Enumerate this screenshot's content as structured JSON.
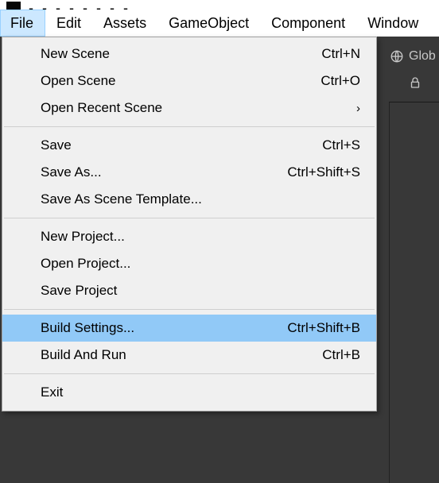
{
  "titlebar": {
    "partial_text": "- - - - - - - -"
  },
  "menubar": {
    "items": [
      {
        "label": "File",
        "open": true
      },
      {
        "label": "Edit"
      },
      {
        "label": "Assets"
      },
      {
        "label": "GameObject"
      },
      {
        "label": "Component"
      },
      {
        "label": "Window"
      }
    ]
  },
  "toolbar": {
    "global_label": "Glob"
  },
  "dropdown": {
    "items": [
      {
        "type": "item",
        "label": "New Scene",
        "shortcut": "Ctrl+N",
        "selected": false
      },
      {
        "type": "item",
        "label": "Open Scene",
        "shortcut": "Ctrl+O",
        "selected": false
      },
      {
        "type": "item",
        "label": "Open Recent Scene",
        "submenu": true,
        "selected": false
      },
      {
        "type": "sep"
      },
      {
        "type": "item",
        "label": "Save",
        "shortcut": "Ctrl+S",
        "selected": false
      },
      {
        "type": "item",
        "label": "Save As...",
        "shortcut": "Ctrl+Shift+S",
        "selected": false
      },
      {
        "type": "item",
        "label": "Save As Scene Template...",
        "selected": false
      },
      {
        "type": "sep"
      },
      {
        "type": "item",
        "label": "New Project...",
        "selected": false
      },
      {
        "type": "item",
        "label": "Open Project...",
        "selected": false
      },
      {
        "type": "item",
        "label": "Save Project",
        "selected": false
      },
      {
        "type": "sep"
      },
      {
        "type": "item",
        "label": "Build Settings...",
        "shortcut": "Ctrl+Shift+B",
        "selected": true
      },
      {
        "type": "item",
        "label": "Build And Run",
        "shortcut": "Ctrl+B",
        "selected": false
      },
      {
        "type": "sep"
      },
      {
        "type": "item",
        "label": "Exit",
        "selected": false
      }
    ]
  }
}
